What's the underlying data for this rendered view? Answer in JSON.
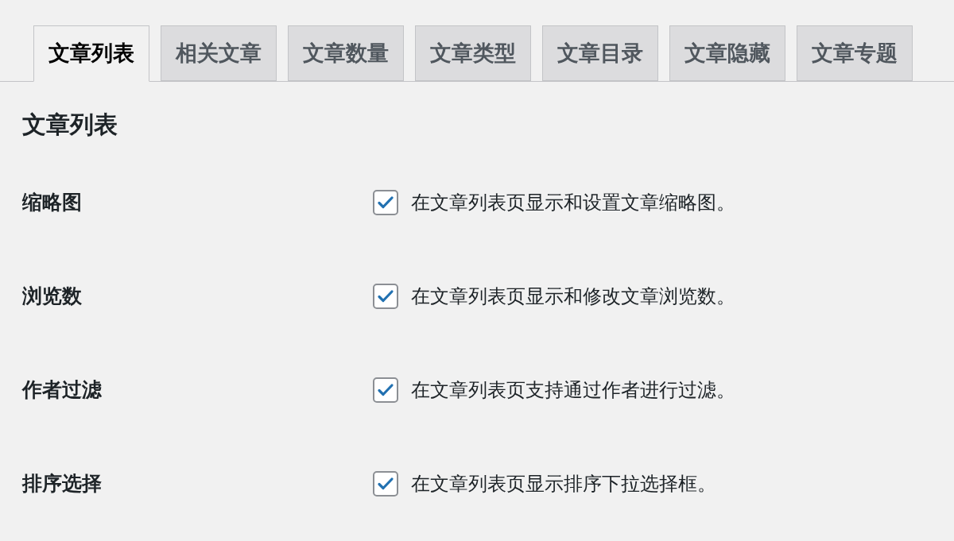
{
  "tabs": [
    {
      "label": "文章列表",
      "selected": true
    },
    {
      "label": "相关文章",
      "selected": false
    },
    {
      "label": "文章数量",
      "selected": false
    },
    {
      "label": "文章类型",
      "selected": false
    },
    {
      "label": "文章目录",
      "selected": false
    },
    {
      "label": "文章隐藏",
      "selected": false
    },
    {
      "label": "文章专题",
      "selected": false
    }
  ],
  "heading": "文章列表",
  "settings": [
    {
      "label": "缩略图",
      "checked": true,
      "description": "在文章列表页显示和设置文章缩略图。"
    },
    {
      "label": "浏览数",
      "checked": true,
      "description": "在文章列表页显示和修改文章浏览数。"
    },
    {
      "label": "作者过滤",
      "checked": true,
      "description": "在文章列表页支持通过作者进行过滤。"
    },
    {
      "label": "排序选择",
      "checked": true,
      "description": "在文章列表页显示排序下拉选择框。"
    }
  ]
}
